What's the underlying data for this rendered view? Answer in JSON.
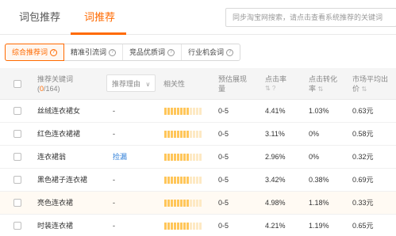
{
  "top_tabs": [
    {
      "label": "词包推荐",
      "active": false
    },
    {
      "label": "词推荐",
      "active": true
    }
  ],
  "search": {
    "placeholder": "同步淘宝网搜索，请点击查看系统推荐的关键词"
  },
  "segments": [
    {
      "label": "综合推荐词",
      "active": true
    },
    {
      "label": "精准引流词",
      "active": false
    },
    {
      "label": "竞品优质词",
      "active": false
    },
    {
      "label": "行业机会词",
      "active": false
    }
  ],
  "table": {
    "headers": {
      "keyword": "推荐关键词",
      "count_open": "(",
      "count_selected": "0",
      "count_total": "/164)",
      "reason": "推荐理由",
      "relevance": "相关性",
      "impressions_line1": "预估展现",
      "impressions_line2": "量",
      "ctr_line1": "点击率",
      "cvr_line1": "点击转化",
      "cvr_line2": "率",
      "avg_price_line1": "市场平均出",
      "avg_price_line2": "价"
    },
    "rows": [
      {
        "keyword": "丝绒连衣裙女",
        "reason": "-",
        "relevance": 8,
        "impressions": "0-5",
        "ctr": "4.41%",
        "cvr": "1.03%",
        "price": "0.63元",
        "highlight": false
      },
      {
        "keyword": "红色连衣裙裙",
        "reason": "-",
        "relevance": 8,
        "impressions": "0-5",
        "ctr": "3.11%",
        "cvr": "0%",
        "price": "0.58元",
        "highlight": false
      },
      {
        "keyword": "连衣裙翁",
        "reason": "捡漏",
        "relevance": 8,
        "impressions": "0-5",
        "ctr": "2.96%",
        "cvr": "0%",
        "price": "0.32元",
        "highlight": false
      },
      {
        "keyword": "黑色裙子连衣裙",
        "reason": "-",
        "relevance": 8,
        "impressions": "0-5",
        "ctr": "3.42%",
        "cvr": "0.38%",
        "price": "0.69元",
        "highlight": false
      },
      {
        "keyword": "亮色连衣裙",
        "reason": "-",
        "relevance": 8,
        "impressions": "0-5",
        "ctr": "4.98%",
        "cvr": "1.18%",
        "price": "0.33元",
        "highlight": true
      },
      {
        "keyword": "时装连衣裙",
        "reason": "-",
        "relevance": 8,
        "impressions": "0-5",
        "ctr": "4.21%",
        "cvr": "1.19%",
        "price": "0.65元",
        "highlight": false
      }
    ]
  },
  "colors": {
    "accent": "#ff6a00",
    "relevance_bar": "#ffc65a",
    "link": "#2f7fd8"
  },
  "icons": {
    "help": "question-circle-icon",
    "dropdown": "chevron-down-icon",
    "sort": "sort-icon"
  }
}
